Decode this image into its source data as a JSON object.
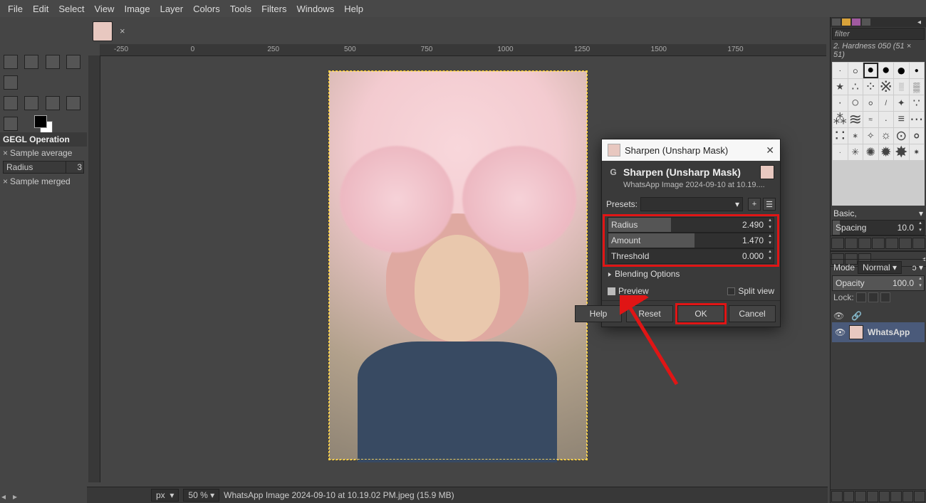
{
  "menu": {
    "file": "File",
    "edit": "Edit",
    "select": "Select",
    "view": "View",
    "image": "Image",
    "layer": "Layer",
    "colors": "Colors",
    "tools": "Tools",
    "filters": "Filters",
    "windows": "Windows",
    "help": "Help"
  },
  "ruler": {
    "marks": [
      "-250",
      "0",
      "250",
      "500",
      "750",
      "1000",
      "1250",
      "1500",
      "1750"
    ]
  },
  "tooloptions": {
    "title": "GEGL Operation",
    "sample_avg": "Sample average",
    "radius_label": "Radius",
    "radius_value": "3",
    "sample_merged": "Sample merged"
  },
  "dialog": {
    "window_title": "Sharpen (Unsharp Mask)",
    "title": "Sharpen (Unsharp Mask)",
    "subtitle": "WhatsApp Image 2024-09-10 at 10.19....",
    "presets_label": "Presets:",
    "radius_label": "Radius",
    "radius_value": "2.490",
    "amount_label": "Amount",
    "amount_value": "1.470",
    "threshold_label": "Threshold",
    "threshold_value": "0.000",
    "blend": "Blending Options",
    "preview": "Preview",
    "split": "Split view",
    "help": "Help",
    "reset": "Reset",
    "ok": "OK",
    "cancel": "Cancel"
  },
  "status": {
    "unit": "px",
    "zoom": "50 %",
    "file": "WhatsApp Image 2024-09-10 at 10.19.02 PM.jpeg (15.9 MB)"
  },
  "right": {
    "filter_placeholder": "filter",
    "brush_info": "2. Hardness 050 (51 × 51)",
    "basic": "Basic,",
    "spacing_label": "Spacing",
    "spacing_value": "10.0",
    "mode_label": "Mode",
    "mode_value": "Normal",
    "opacity_label": "Opacity",
    "opacity_value": "100.0",
    "lock": "Lock:",
    "layer_name": "WhatsApp"
  }
}
